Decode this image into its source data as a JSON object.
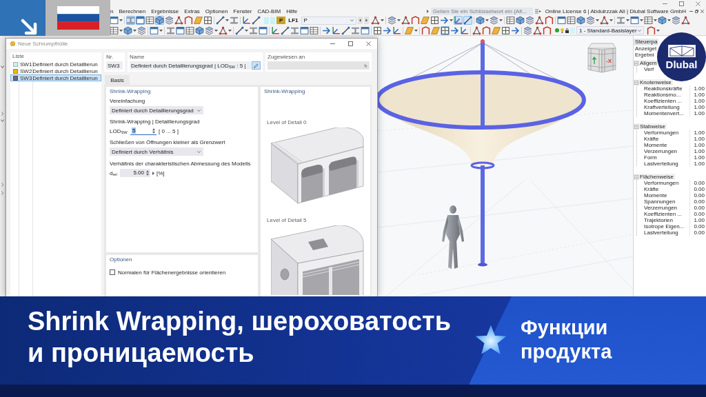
{
  "menu": [
    "n",
    "Berechnen",
    "Ergebnisse",
    "Extras",
    "Optionen",
    "Fenster",
    "CAD-BIM",
    "Hilfe"
  ],
  "search": {
    "placeholder": "Geben Sie ein Schlüsselwort ein (Alt..."
  },
  "license": "Online License 6 | Abdulrzzak Ali | Dlubal Software GmbH",
  "toolbar": {
    "row_1": {
      "groups_before": [
        [
          {
            "pressed": false,
            "menu": true
          }
        ],
        [
          {
            "pressed": true,
            "menu": false
          },
          {
            "pressed": true,
            "menu": false
          },
          {
            "pressed": false,
            "menu": false
          },
          {
            "pressed": true,
            "menu": false
          },
          {
            "pressed": false,
            "menu": false
          },
          {
            "pressed": false,
            "menu": false
          },
          {
            "pressed": false,
            "menu": false
          },
          {
            "pressed": false,
            "menu": false
          },
          {
            "pressed": false,
            "menu": false
          }
        ],
        [
          {
            "pressed": false,
            "menu": true
          },
          {
            "pressed": false,
            "menu": false
          }
        ],
        [
          {
            "pressed": false,
            "menu": false
          },
          {
            "pressed": false,
            "menu": false
          }
        ]
      ],
      "load_case": {
        "category": "P",
        "code": "LF1",
        "name": "P"
      },
      "groups_after": [
        [
          {
            "pressed": false,
            "menu": true
          }
        ],
        [
          {
            "pressed": false,
            "menu": true
          },
          {
            "pressed": false,
            "menu": false
          },
          {
            "pressed": false,
            "menu": false
          },
          {
            "pressed": false,
            "menu": false
          },
          {
            "pressed": false,
            "menu": false
          },
          {
            "pressed": false,
            "menu": true
          },
          {
            "pressed": true,
            "menu": false
          },
          {
            "pressed": true,
            "menu": false
          }
        ],
        [
          {
            "pressed": false,
            "menu": true
          },
          {
            "pressed": false,
            "menu": true
          }
        ],
        [
          {
            "pressed": false,
            "menu": false
          },
          {
            "pressed": false,
            "menu": false
          },
          {
            "pressed": false,
            "menu": false
          },
          {
            "pressed": false,
            "menu": false
          },
          {
            "pressed": false,
            "menu": false
          }
        ],
        [
          {
            "pressed": false,
            "menu": false
          },
          {
            "pressed": false,
            "menu": false
          },
          {
            "pressed": false,
            "menu": false
          },
          {
            "pressed": false,
            "menu": true
          },
          {
            "pressed": false,
            "menu": true
          }
        ],
        [
          {
            "pressed": false,
            "menu": true
          },
          {
            "pressed": false,
            "menu": true
          },
          {
            "pressed": false,
            "menu": true
          },
          {
            "pressed": false,
            "menu": true
          },
          {
            "pressed": false,
            "menu": false
          },
          {
            "pressed": false,
            "menu": false
          }
        ]
      ]
    },
    "row_2": {
      "groups_before": [
        [
          {
            "pressed": false,
            "menu": true
          },
          {
            "pressed": false,
            "menu": true
          },
          {
            "pressed": false,
            "menu": false
          }
        ],
        [
          {
            "pressed": false,
            "menu": true
          }
        ],
        [
          {
            "pressed": false,
            "menu": false
          },
          {
            "pressed": false,
            "menu": false
          },
          {
            "pressed": false,
            "menu": false
          },
          {
            "pressed": false,
            "menu": false
          },
          {
            "pressed": false,
            "menu": true
          },
          {
            "pressed": false,
            "menu": true
          }
        ],
        [
          {
            "pressed": false,
            "menu": true
          },
          {
            "pressed": false,
            "menu": false
          },
          {
            "pressed": false,
            "menu": false
          }
        ],
        [
          {
            "pressed": false,
            "menu": false
          },
          {
            "pressed": false,
            "menu": false
          },
          {
            "pressed": false,
            "menu": false
          },
          {
            "pressed": false,
            "menu": false
          },
          {
            "pressed": false,
            "menu": false
          }
        ],
        [
          {
            "pressed": false,
            "menu": false
          },
          {
            "pressed": false,
            "menu": false
          },
          {
            "pressed": false,
            "menu": false
          },
          {
            "pressed": false,
            "menu": false
          },
          {
            "pressed": false,
            "menu": false
          }
        ],
        [
          {
            "pressed": false,
            "menu": false
          },
          {
            "pressed": false,
            "menu": false
          },
          {
            "pressed": false,
            "menu": false
          }
        ],
        [
          {
            "pressed": false,
            "menu": true
          }
        ],
        [
          {
            "pressed": false,
            "menu": false
          },
          {
            "pressed": false,
            "menu": false
          },
          {
            "pressed": true,
            "menu": false
          },
          {
            "pressed": false,
            "menu": false
          },
          {
            "pressed": false,
            "menu": false
          }
        ],
        [
          {
            "pressed": false,
            "menu": false
          },
          {
            "pressed": false,
            "menu": false
          },
          {
            "pressed": false,
            "menu": false
          },
          {
            "pressed": false,
            "menu": false
          },
          {
            "pressed": false,
            "menu": false
          }
        ],
        [
          {
            "pressed": false,
            "menu": false
          },
          {
            "pressed": false,
            "menu": false
          },
          {
            "pressed": false,
            "menu": false
          }
        ]
      ],
      "layer": {
        "name": "1 - Standard-Basislayer"
      },
      "groups_after": [
        [
          {
            "pressed": false,
            "menu": true
          }
        ]
      ]
    }
  },
  "dialog": {
    "title": "Neue Schrumpfhülle",
    "list": {
      "header": "Liste",
      "items": [
        {
          "code": "SW1",
          "name": "Definiert durch Detaillierun",
          "color": "#c8f2f6",
          "selected": false
        },
        {
          "code": "SW2",
          "name": "Definiert durch Detaillierun",
          "color": "#f2b705",
          "selected": false
        },
        {
          "code": "SW3",
          "name": "Definiert durch Detaillierun",
          "color": "#6f6880",
          "selected": true
        }
      ]
    },
    "number": {
      "label": "Nr.",
      "value": "SW3"
    },
    "name": {
      "label": "Name",
      "value": "Definiert durch Detaillierungsgrad | LOD$_{SW}$ : 5 |"
    },
    "assigned": {
      "label": "Zugewiesen an",
      "disabled": true
    },
    "tabs": [
      {
        "label": "Basis",
        "selected": true
      }
    ],
    "settings": {
      "title": "Shrink-Wrapping",
      "simplification": {
        "label": "Vereinfachung",
        "value": "Definiert durch Detaillierungsgrad"
      },
      "detail_level": {
        "label": "Shrink-Wrapping | Detaillierungsgrad",
        "symbol": "LOD$_{SW}$",
        "value": "5",
        "focused": true,
        "range": "[ 0 ... 5 ]"
      },
      "openings": {
        "label": "Schließen von Öffnungen kleiner als Grenzwert",
        "value": "Definiert durch Verhältnis"
      },
      "ratio": {
        "label": "Verhältnis der charakteristischen Abmessung des Modells",
        "symbol": "d$_{rel}$",
        "value": "5.00",
        "focused": false,
        "unit": "[%]"
      }
    },
    "options": {
      "title": "Optionen",
      "items": [
        {
          "label": "Normalen für Flächenergebnisse orientieren",
          "checked": false
        }
      ]
    },
    "preview": {
      "title": "Shrink-Wrapping",
      "items": [
        {
          "caption": "Level of Detail 0",
          "kind": "coarse"
        },
        {
          "caption": "Level of Detail 5",
          "kind": "fine"
        }
      ]
    }
  },
  "viewport": {
    "view_cube": {
      "axis_label": "-X"
    }
  },
  "control_panel": {
    "title": "Steuerpa",
    "lines": [
      "Anzeiget",
      "Ergebni"
    ],
    "groups": [
      {
        "label": "Allgem",
        "expanded": true,
        "children": [
          {
            "label": "Verf"
          }
        ]
      },
      {
        "label": "Knotenweise",
        "expanded": true,
        "children": [
          {
            "label": "Reaktionskräfte",
            "value": "1.00"
          },
          {
            "label": "Reaktionsmo...",
            "value": "1.00"
          },
          {
            "label": "Koeffizienten ...",
            "value": "1.00"
          },
          {
            "label": "Kraftverteilung",
            "value": "1.00"
          },
          {
            "label": "Momentenvert...",
            "value": "1.00"
          }
        ]
      },
      {
        "label": "Stabweise",
        "expanded": true,
        "children": [
          {
            "label": "Verformungen",
            "value": "1.00"
          },
          {
            "label": "Kräfte",
            "value": "1.00"
          },
          {
            "label": "Momente",
            "value": "1.00"
          },
          {
            "label": "Verzerrungen",
            "value": "1.00"
          },
          {
            "label": "Form",
            "value": "1.00"
          },
          {
            "label": "Lastverteilung",
            "value": "1.00"
          }
        ]
      },
      {
        "label": "Flächenweise",
        "expanded": true,
        "children": [
          {
            "label": "Verformungen",
            "value": "0.00"
          },
          {
            "label": "Kräfte",
            "value": "0.00"
          },
          {
            "label": "Momente",
            "value": "0.00"
          },
          {
            "label": "Spannungen",
            "value": "0.00"
          },
          {
            "label": "Verzerrungen",
            "value": "0.00"
          },
          {
            "label": "Koeffizienten ...",
            "value": "0.00"
          },
          {
            "label": "Trajektorien",
            "value": "1.00"
          },
          {
            "label": "Isotrope Eigen...",
            "value": "0.00"
          },
          {
            "label": "Lastverteilung",
            "value": "0.00"
          }
        ]
      }
    ]
  },
  "logo": {
    "text": "Dlubal"
  },
  "banner": {
    "headline": "Shrink Wrapping, шероховатость\nи проницаемость",
    "feature": "Функции\nпродукта"
  }
}
